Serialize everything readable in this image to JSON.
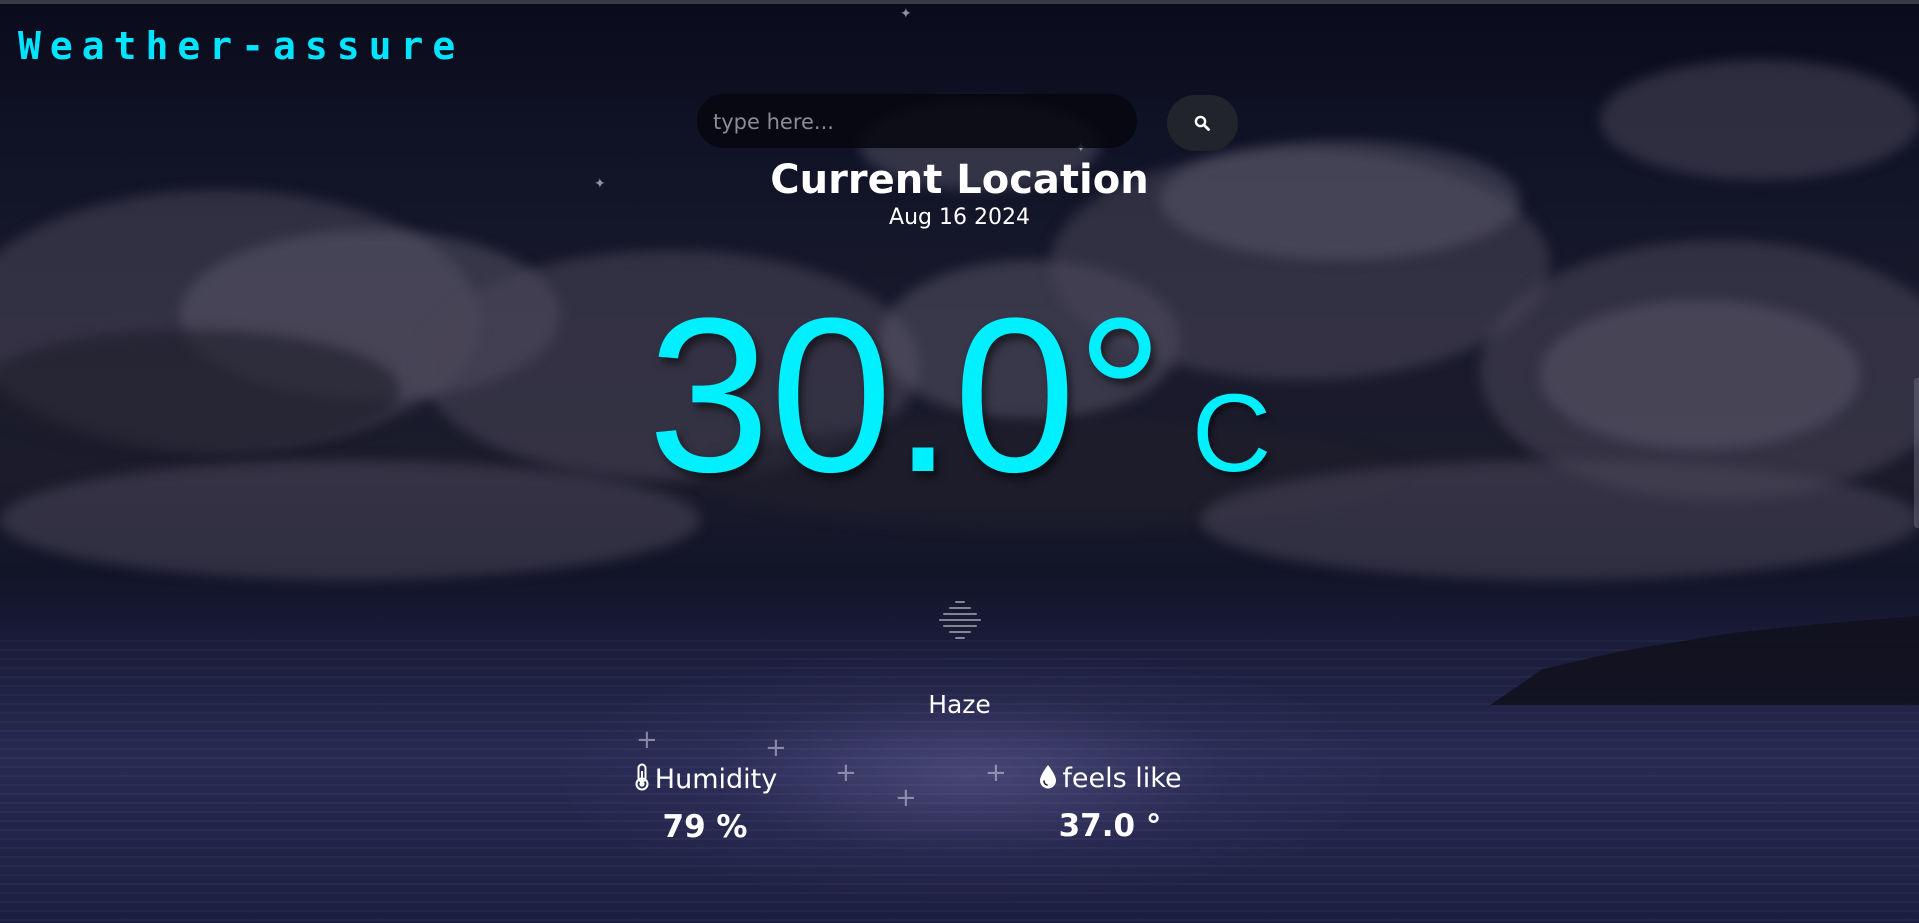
{
  "app": {
    "brand": "Weather-assure"
  },
  "search": {
    "placeholder": "type here...",
    "value": "",
    "button_icon": "search-icon"
  },
  "location": {
    "name": "Current Location",
    "date": "Aug 16 2024"
  },
  "temperature": {
    "value": "30.0°",
    "unit": "C"
  },
  "weather": {
    "condition_icon": "haze-icon",
    "condition": "Haze"
  },
  "stats": {
    "humidity": {
      "icon": "thermometer-icon",
      "label": "Humidity",
      "value": "79 %"
    },
    "feels_like": {
      "icon": "droplet-icon",
      "label": "feels like",
      "value": "37.0 °"
    }
  },
  "colors": {
    "accent": "#00f0ff",
    "text": "#ffffff",
    "background": "#111327"
  }
}
